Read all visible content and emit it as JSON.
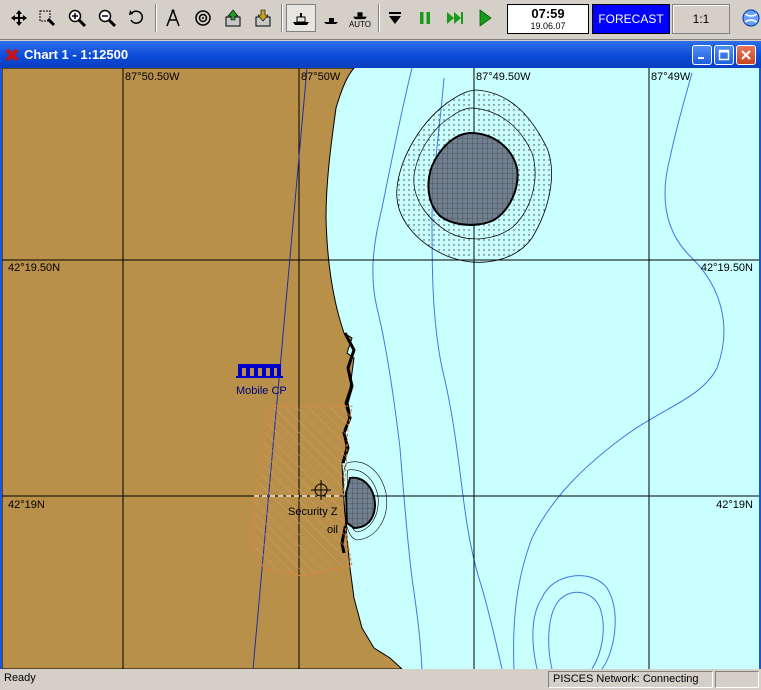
{
  "toolbar": {
    "buttons": [
      {
        "name": "pan-tool",
        "icon": "move-arrows-icon"
      },
      {
        "name": "select-zoom",
        "icon": "zoom-box-icon"
      },
      {
        "name": "zoom-in",
        "icon": "zoom-in-icon"
      },
      {
        "name": "zoom-out",
        "icon": "zoom-out-icon"
      },
      {
        "name": "undo-view",
        "icon": "undo-icon"
      },
      {
        "name": "measure",
        "icon": "compass-icon"
      },
      {
        "name": "target",
        "icon": "target-icon"
      },
      {
        "name": "export",
        "icon": "export-icon"
      },
      {
        "name": "import",
        "icon": "import-icon"
      },
      {
        "name": "ship-mode",
        "icon": "ship-icon"
      },
      {
        "name": "ship-track",
        "icon": "ship-small-icon"
      },
      {
        "name": "auto-mode",
        "icon": "ship-auto-icon"
      },
      {
        "name": "step-down",
        "icon": "step-down-icon"
      },
      {
        "name": "pause",
        "icon": "pause-icon"
      },
      {
        "name": "fast-forward",
        "icon": "fast-forward-icon"
      },
      {
        "name": "play",
        "icon": "play-icon"
      }
    ],
    "auto_label": "AUTO",
    "clock_time": "07:59",
    "clock_date": "19.06.07",
    "forecast_label": "FORECAST",
    "scale_label": "1:1"
  },
  "window": {
    "title": "Chart 1 - 1:12500"
  },
  "chart": {
    "longitudes": [
      "87°50.50W",
      "87°50W",
      "87°49.50W",
      "87°49W"
    ],
    "latitudes": [
      "42°19.50N",
      "42°19N"
    ],
    "features": {
      "mobile_cp_label": "Mobile CP",
      "security_zone_label": "Security Z",
      "oil_label": "oil"
    },
    "colors": {
      "land": "#b8904a",
      "water": "#caffff",
      "isobath": "#3c78e8",
      "grid": "#000000",
      "security_zone": "#e8803a",
      "mobile_cp": "#0000cc"
    }
  },
  "status": {
    "ready": "Ready",
    "network": "PISCES Network: Connecting"
  }
}
